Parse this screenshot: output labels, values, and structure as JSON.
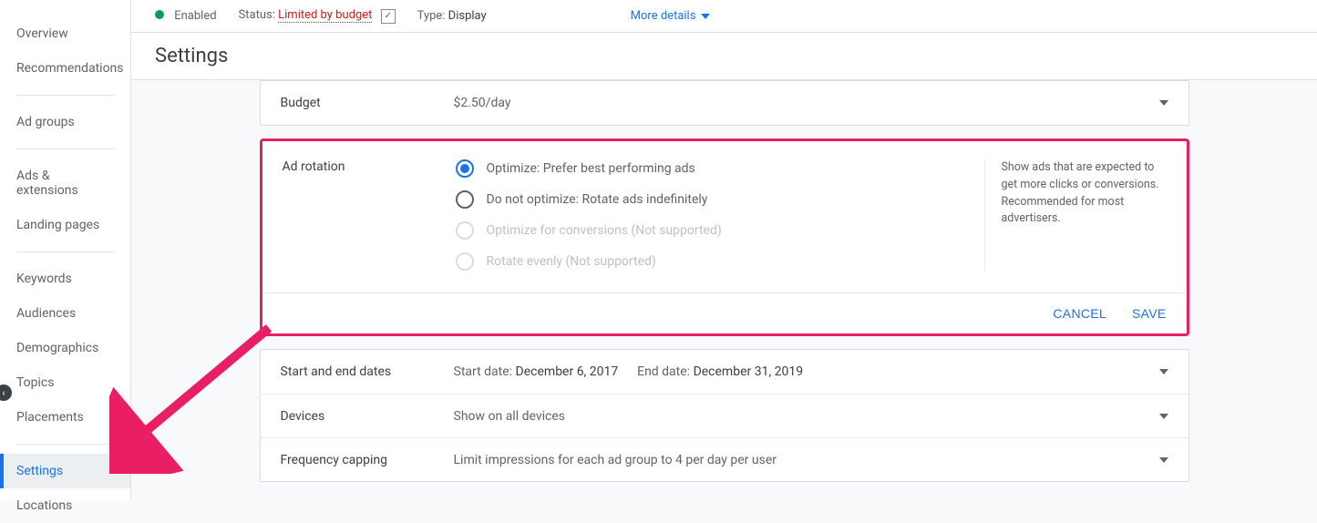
{
  "sidebar": {
    "items": [
      {
        "label": "Overview"
      },
      {
        "label": "Recommendations"
      },
      {
        "label": "Ad groups"
      },
      {
        "label": "Ads & extensions"
      },
      {
        "label": "Landing pages"
      },
      {
        "label": "Keywords"
      },
      {
        "label": "Audiences"
      },
      {
        "label": "Demographics"
      },
      {
        "label": "Topics"
      },
      {
        "label": "Placements"
      },
      {
        "label": "Settings"
      },
      {
        "label": "Locations"
      }
    ]
  },
  "topbar": {
    "enabled_label": "Enabled",
    "status_label": "Status:",
    "status_value": "Limited by budget",
    "type_label": "Type:",
    "type_value": "Display",
    "more_label": "More details"
  },
  "page_title": "Settings",
  "budget": {
    "title": "Budget",
    "value": "$2.50/day"
  },
  "ad_rotation": {
    "title": "Ad rotation",
    "options": [
      {
        "label": "Optimize: Prefer best performing ads",
        "checked": true,
        "enabled": true
      },
      {
        "label": "Do not optimize: Rotate ads indefinitely",
        "checked": false,
        "enabled": true
      },
      {
        "label": "Optimize for conversions (Not supported)",
        "checked": false,
        "enabled": false
      },
      {
        "label": "Rotate evenly (Not supported)",
        "checked": false,
        "enabled": false
      }
    ],
    "help": "Show ads that are expected to get more clicks or conversions. Recommended for most advertisers.",
    "cancel": "CANCEL",
    "save": "SAVE"
  },
  "dates": {
    "title": "Start and end dates",
    "start_label": "Start date:",
    "start_value": "December 6, 2017",
    "end_label": "End date:",
    "end_value": "December 31, 2019"
  },
  "devices": {
    "title": "Devices",
    "value": "Show on all devices"
  },
  "freq": {
    "title": "Frequency capping",
    "value": "Limit impressions for each ad group to 4 per day per user"
  }
}
